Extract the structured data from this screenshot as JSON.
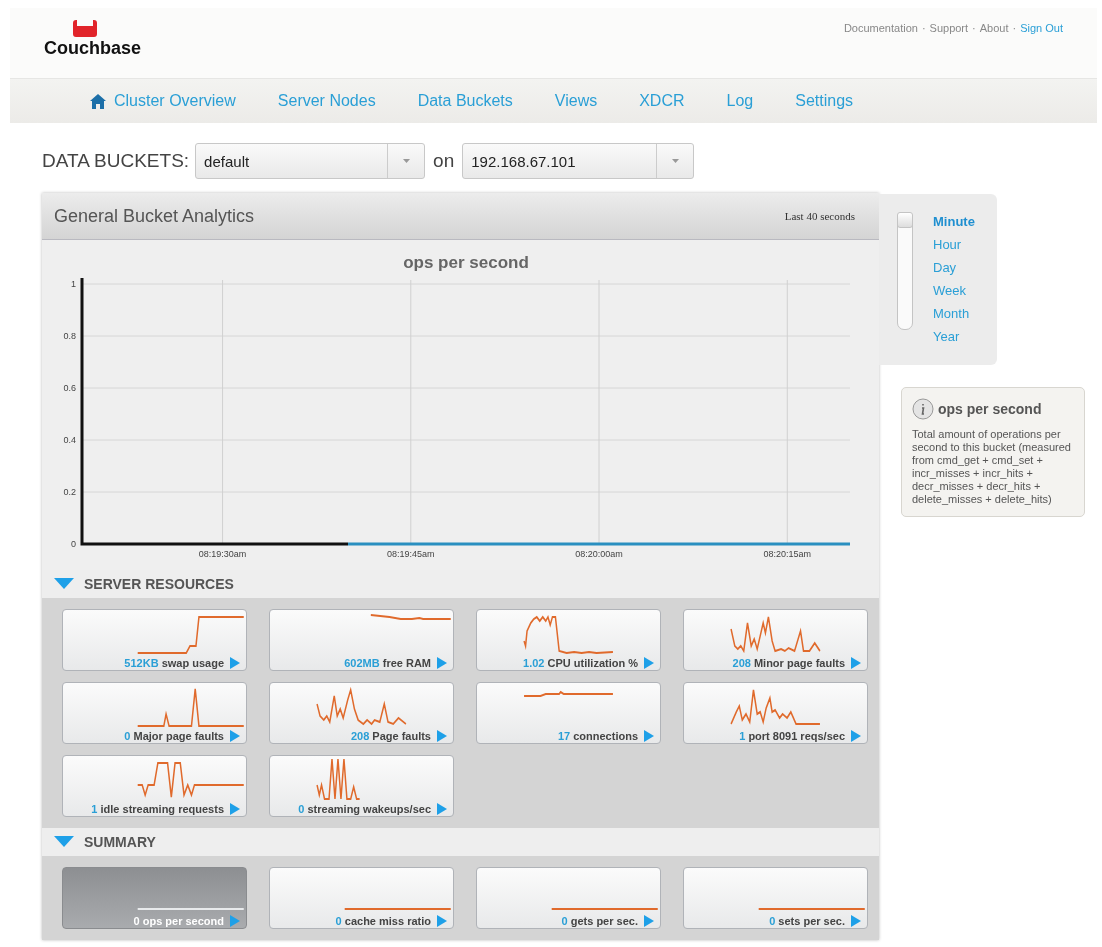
{
  "logo": {
    "text": "Couchbase"
  },
  "top_links": [
    {
      "label": "Documentation",
      "kind": "plain"
    },
    {
      "label": "·",
      "kind": "separator"
    },
    {
      "label": "Support",
      "kind": "plain"
    },
    {
      "label": "·",
      "kind": "separator"
    },
    {
      "label": "About",
      "kind": "plain"
    },
    {
      "label": "·",
      "kind": "separator"
    },
    {
      "label": "Sign Out",
      "kind": "accent"
    }
  ],
  "nav": [
    {
      "label": "Cluster Overview",
      "icon": true
    },
    {
      "label": "Server Nodes",
      "icon": false
    },
    {
      "label": "Data Buckets",
      "icon": false
    },
    {
      "label": "Views",
      "icon": false
    },
    {
      "label": "XDCR",
      "icon": false
    },
    {
      "label": "Log",
      "icon": false
    },
    {
      "label": "Settings",
      "icon": false
    }
  ],
  "selector": {
    "label": "DATA BUCKETS:",
    "bucket": "default",
    "joiner": "on",
    "server": "192.168.67.101"
  },
  "analytics": {
    "title": "General Bucket Analytics",
    "range": "Last 40 seconds",
    "chart_data": {
      "type": "line",
      "title": "ops per second",
      "grid": true,
      "ylim": [
        0,
        1
      ],
      "categories": [
        null,
        null,
        "08:19:30am",
        null,
        null,
        "08:19:45am",
        null,
        null,
        "08:20:00am",
        null,
        null,
        "08:20:15am",
        null
      ],
      "yticks": [
        0,
        0.2,
        0.4,
        0.6,
        0.8,
        1
      ],
      "series": [
        {
          "color": "#2a8fc0",
          "values": [
            null,
            null,
            null,
            null,
            0,
            0,
            0,
            0,
            0,
            0,
            0,
            0,
            0
          ]
        }
      ]
    }
  },
  "sections": [
    {
      "title": "SERVER RESOURCES",
      "expanded": true,
      "cards": [
        {
          "value": "512KB",
          "label": "swap usage",
          "selected": false
        },
        {
          "value": "602MB",
          "label": "free RAM",
          "selected": false
        },
        {
          "value": "1.02",
          "label": "CPU utilization %",
          "selected": false
        },
        {
          "value": "208",
          "label": "Minor page faults",
          "selected": false
        },
        {
          "value": "0",
          "label": "Major page faults",
          "selected": false
        },
        {
          "value": "208",
          "label": "Page faults",
          "selected": false
        },
        {
          "value": "17",
          "label": "connections",
          "selected": false
        },
        {
          "value": "1",
          "label": "port 8091 reqs/sec",
          "selected": false
        },
        {
          "value": "1",
          "label": "idle streaming requests",
          "selected": false
        },
        {
          "value": "0",
          "label": "streaming wakeups/sec",
          "selected": false
        }
      ]
    },
    {
      "title": "SUMMARY",
      "expanded": true,
      "cards": [
        {
          "value": "0",
          "label": "ops per second",
          "selected": true
        },
        {
          "value": "0",
          "label": "cache miss ratio",
          "selected": false
        },
        {
          "value": "0",
          "label": "gets per sec.",
          "selected": false
        },
        {
          "value": "0",
          "label": "sets per sec.",
          "selected": false
        }
      ]
    }
  ],
  "zoom_slider": {
    "level": 1
  },
  "zoom": [
    {
      "label": "Minute",
      "selected": true
    },
    {
      "label": "Hour",
      "selected": false
    },
    {
      "label": "Day",
      "selected": false
    },
    {
      "label": "Week",
      "selected": false
    },
    {
      "label": "Month",
      "selected": false
    },
    {
      "label": "Year",
      "selected": false
    }
  ],
  "info": {
    "title": "ops per second",
    "text": "Total amount of operations per second to this bucket (measured from cmd_get + cmd_set + incr_misses + incr_hits + decr_misses + decr_hits + delete_misses + delete_hits)"
  }
}
